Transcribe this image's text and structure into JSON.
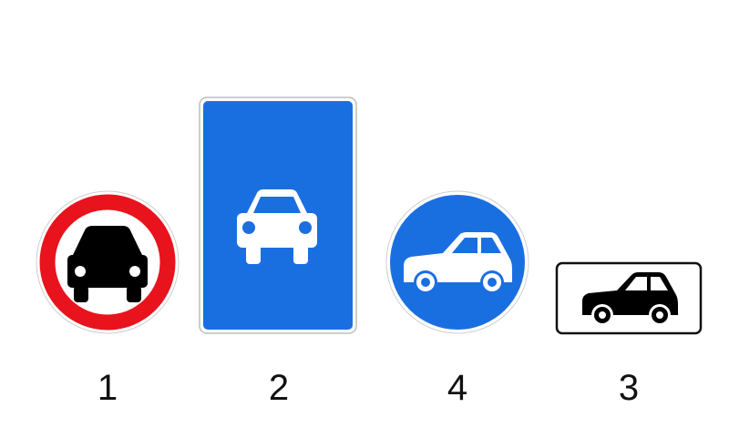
{
  "signs": [
    {
      "number": "1",
      "icon": "car-front-icon",
      "ring_color": "#e8131c",
      "fill_color": "#ffffff",
      "car_color": "#000000"
    },
    {
      "number": "2",
      "icon": "car-front-icon",
      "fill_color": "#1a6fe0",
      "car_color": "#ffffff"
    },
    {
      "number": "4",
      "icon": "car-side-icon",
      "fill_color": "#1a6fe0",
      "car_color": "#ffffff"
    },
    {
      "number": "3",
      "icon": "car-side-icon",
      "fill_color": "#ffffff",
      "car_color": "#000000"
    }
  ]
}
